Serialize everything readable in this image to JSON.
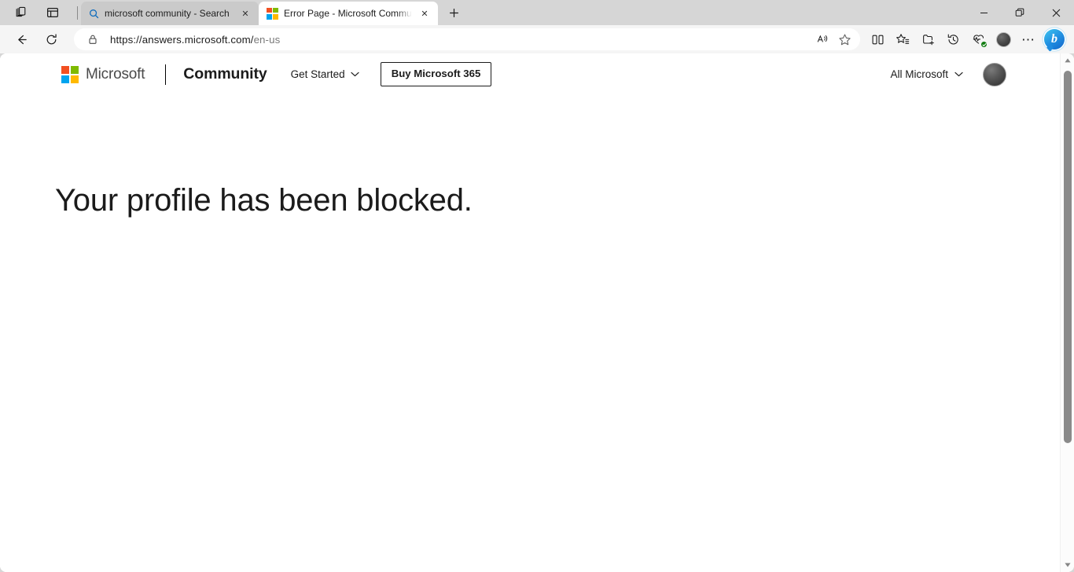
{
  "browser": {
    "titlebar": {
      "tab_actions_icon": "tab-actions-icon",
      "tab_search_icon": "vertical-tabs-icon",
      "new_tab_label": "+",
      "window_controls": {
        "minimize": "minimize-icon",
        "restore": "restore-icon",
        "close": "close-icon"
      }
    },
    "tabs": [
      {
        "title": "microsoft community - Search",
        "favicon": "search-icon",
        "active": false,
        "close_label": "✕"
      },
      {
        "title": "Error Page - Microsoft Community",
        "favicon": "microsoft-logo-icon",
        "active": true,
        "close_label": "✕"
      }
    ],
    "toolbar": {
      "back_icon": "back-arrow-icon",
      "refresh_icon": "refresh-icon",
      "address": {
        "lock_icon": "lock-icon",
        "url_main": "https://answers.microsoft.com/",
        "url_path": "en-us",
        "read_aloud_icon": "read-aloud-icon",
        "favorite_icon": "star-icon"
      },
      "actions": [
        {
          "name": "split-screen-icon",
          "label": "Split screen"
        },
        {
          "name": "favorites-icon",
          "label": "Favorites"
        },
        {
          "name": "collections-icon",
          "label": "Collections"
        },
        {
          "name": "history-icon",
          "label": "History"
        },
        {
          "name": "browser-essentials-icon",
          "label": "Browser essentials"
        },
        {
          "name": "profile-avatar",
          "label": "Profile"
        },
        {
          "name": "settings-more-icon",
          "label": "Settings and more"
        },
        {
          "name": "copilot-icon",
          "label": "Copilot"
        }
      ],
      "copilot_glyph": "b",
      "more_glyph": "⋯"
    },
    "scrollbar": {
      "up_arrow": "▲",
      "down_arrow": "▼"
    }
  },
  "page": {
    "header": {
      "logo_name": "microsoft-logo",
      "brand": "Microsoft",
      "product": "Community",
      "get_started": "Get Started",
      "get_started_chevron": "chevron-down-icon",
      "buy_button": "Buy Microsoft 365",
      "all_microsoft": "All Microsoft",
      "all_microsoft_chevron": "chevron-down-icon",
      "avatar_name": "user-avatar"
    },
    "content": {
      "headline": "Your profile has been blocked."
    }
  },
  "colors": {
    "ms_red": "#F25022",
    "ms_green": "#7FBA00",
    "ms_blue": "#00A4EF",
    "ms_yellow": "#FFB900",
    "titlebar_bg": "#D6D6D6",
    "toolbar_bg": "#F5F5F5",
    "page_bg": "#FFFFFF",
    "text": "#1B1B1B",
    "badge_green": "#107C10"
  }
}
